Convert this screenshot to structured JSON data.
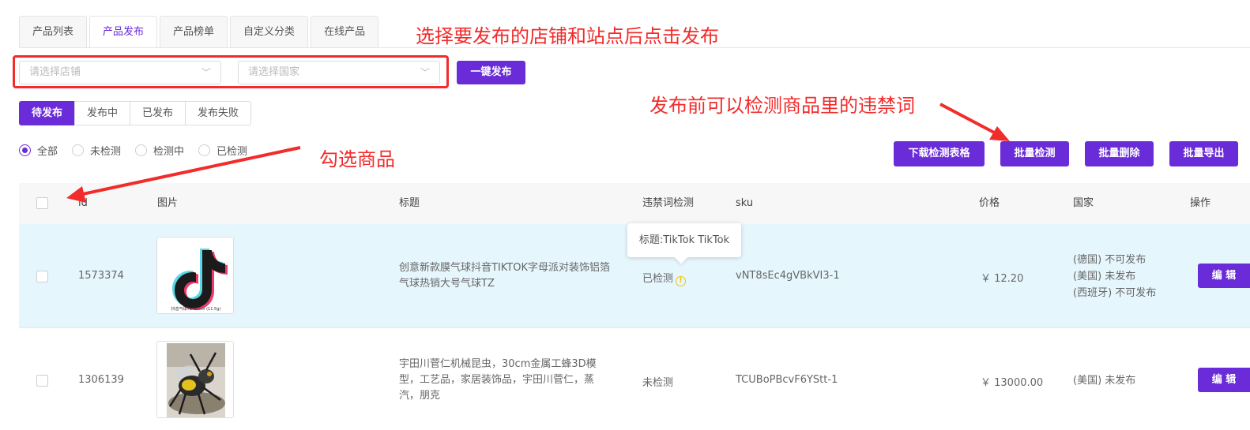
{
  "tabs": [
    "产品列表",
    "产品发布",
    "产品榜单",
    "自定义分类",
    "在线产品"
  ],
  "active_tab": "产品发布",
  "filters": {
    "shop_placeholder": "请选择店铺",
    "country_placeholder": "请选择国家",
    "publish_button": "一键发布"
  },
  "status_tabs": [
    "待发布",
    "发布中",
    "已发布",
    "发布失败"
  ],
  "radios": [
    "全部",
    "未检测",
    "检测中",
    "已检测"
  ],
  "actions": {
    "download": "下载检测表格",
    "batch_check": "批量检测",
    "batch_delete": "批量删除",
    "batch_export": "批量导出"
  },
  "annotations": {
    "select_shop": "选择要发布的店铺和站点后点击发布",
    "check_words": "发布前可以检测商品里的违禁词",
    "select_goods": "勾选商品"
  },
  "columns": {
    "id": "id",
    "image": "图片",
    "title": "标题",
    "forbidden": "违禁词检测",
    "sku": "sku",
    "price": "价格",
    "country": "国家",
    "ops": "操作"
  },
  "rows": [
    {
      "id": "1573374",
      "title": "创意新款膜气球抖音TIKTOK字母派对装饰铝箔气球热销大号气球TZ",
      "check": "已检测",
      "sku": "vNT8sEc4gVBkVI3-1",
      "price": "￥ 12.20",
      "countries": [
        "(德国) 不可发布",
        "(美国) 未发布",
        "(西班牙) 不可发布"
      ],
      "edit": "编 辑",
      "thumb_caption": "抖音气球70*61cm (11.5g)"
    },
    {
      "id": "1306139",
      "title": "宇田川菅仁机械昆虫，30cm金属工蜂3D模型，工艺品，家居装饰品，宇田川菅仁，蒸汽，朋克",
      "check": "未检测",
      "sku": "TCUBoPBcvF6YStt-1",
      "price": "￥ 13000.00",
      "countries": [
        "(美国) 未发布"
      ],
      "edit": "编 辑"
    }
  ],
  "tooltip": "标题:TikTok TikTok",
  "colors": {
    "accent": "#6a2bd8",
    "annotation": "#f22b2b",
    "warning": "#f2c200",
    "row_highlight": "#e6f6fd"
  }
}
